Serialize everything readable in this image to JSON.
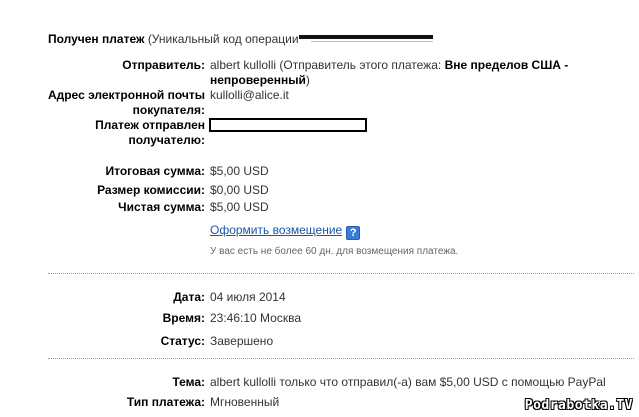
{
  "header": {
    "title": "Получен платеж",
    "subtitle": "(Уникальный код операции"
  },
  "details": {
    "sender_label": "Отправитель:",
    "sender_name": "albert kullolli",
    "sender_note_prefix": "(Отправитель этого платежа:",
    "sender_note_bold": "Вне пределов США - непроверенный",
    "sender_note_suffix": ")",
    "email_label_line1": "Адрес электронной почты",
    "email_label_line2": "покупателя:",
    "email_value": "kullolli@alice.it",
    "recipient_label_line1": "Платеж отправлен",
    "recipient_label_line2": "получателю:"
  },
  "amounts": {
    "total_label": "Итоговая сумма:",
    "total_value": "$5,00 USD",
    "fee_label": "Размер комиссии:",
    "fee_value": "$0,00 USD",
    "net_label": "Чистая сумма:",
    "net_value": "$5,00 USD",
    "refund_link": "Оформить возмещение",
    "help_icon_glyph": "?",
    "refund_note": "У вас есть не более 60 дн. для возмещения платежа."
  },
  "meta": {
    "date_label": "Дата:",
    "date_value": "04 июля 2014",
    "time_label": "Время:",
    "time_value": "23:46:10 Москва",
    "status_label": "Статус:",
    "status_value": "Завершено"
  },
  "subject": {
    "subject_label": "Тема:",
    "subject_value": "albert kullolli только что отправил(-а) вам $5,00 USD с помощью PayPal",
    "type_label": "Тип платежа:",
    "type_value": "Мгновенный"
  },
  "watermark": "Podrabotka.TV",
  "colors": {
    "link": "#1a56a8",
    "help_icon": "#3a7bd5",
    "divider": "#9a9a9a"
  }
}
